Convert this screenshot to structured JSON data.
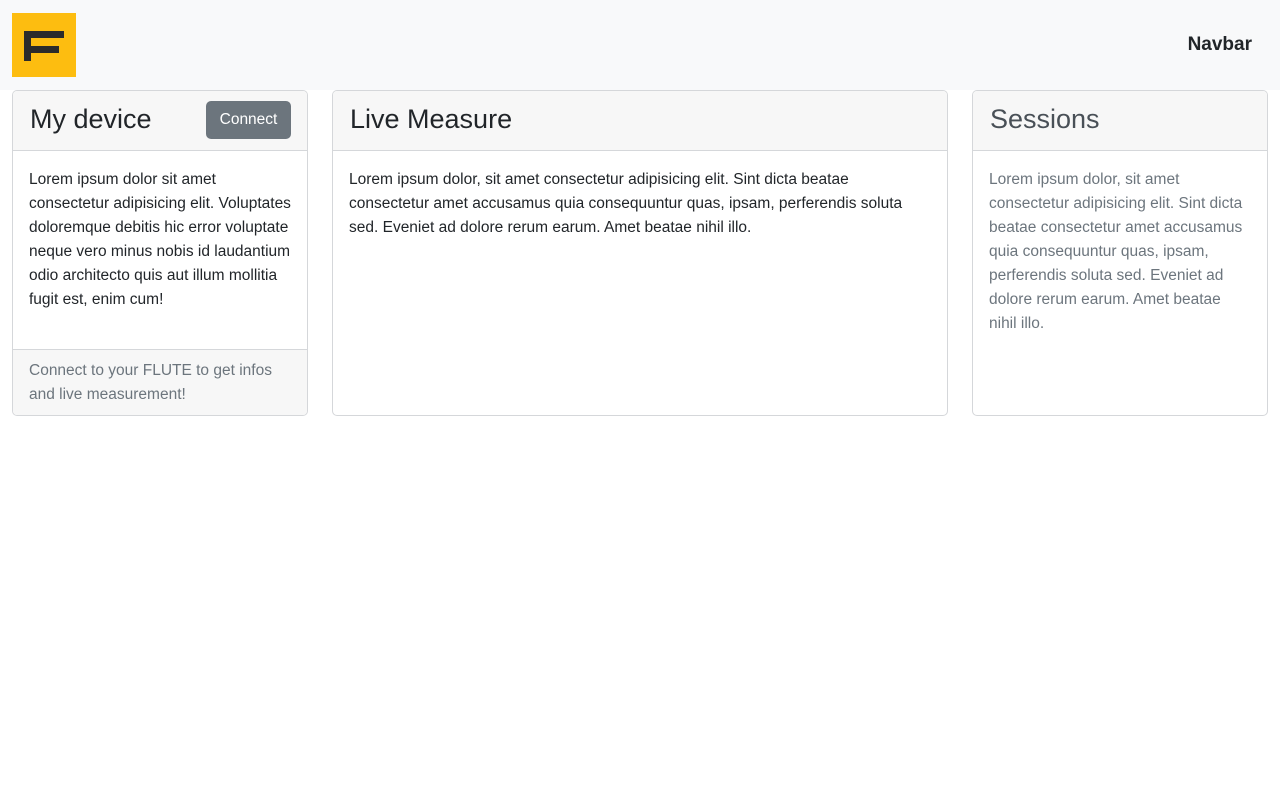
{
  "navbar": {
    "logo_icon": "flute-logo-icon",
    "logo_color": "#fdbd10",
    "brand": "Navbar"
  },
  "cards": {
    "device": {
      "title": "My device",
      "button": "Connect",
      "body": "Lorem ipsum dolor sit amet consectetur adipisicing elit. Voluptates doloremque debitis hic error voluptate neque vero minus nobis id laudantium odio architecto quis aut illum mollitia fugit est, enim cum!",
      "footer": "Connect to your FLUTE to get infos and live measurement!"
    },
    "live": {
      "title": "Live Measure",
      "body": "Lorem ipsum dolor, sit amet consectetur adipisicing elit. Sint dicta beatae consectetur amet accusamus quia consequuntur quas, ipsam, perferendis soluta sed. Eveniet ad dolore rerum earum. Amet beatae nihil illo."
    },
    "sessions": {
      "title": "Sessions",
      "body": "Lorem ipsum dolor, sit amet consectetur adipisicing elit. Sint dicta beatae consectetur amet accusamus quia consequuntur quas, ipsam, perferendis soluta sed. Eveniet ad dolore rerum earum. Amet beatae nihil illo."
    }
  },
  "colors": {
    "button_secondary": "#6c757d",
    "navbar_bg": "#f8f9fa"
  }
}
